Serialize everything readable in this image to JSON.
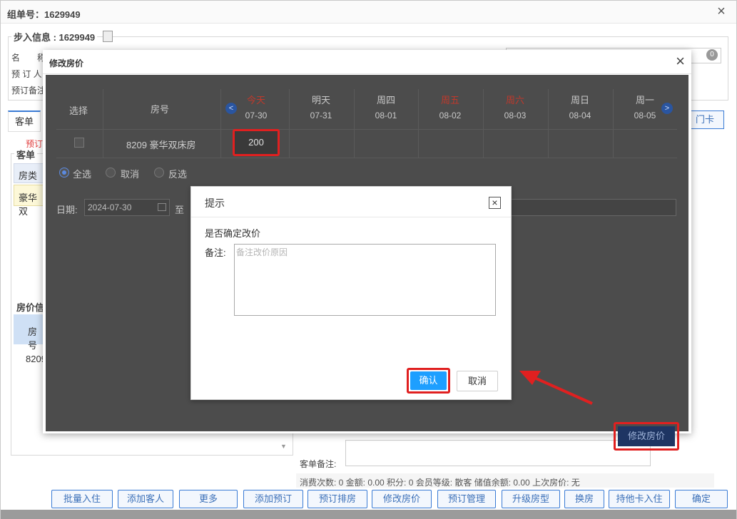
{
  "window": {
    "title": "组单号：1629949",
    "close": "×"
  },
  "step_info": {
    "legend": "步入信息 : 1629949",
    "name_label": "名　　称",
    "booker_label": "预 订 人",
    "remark_label": "预订备注",
    "badge": "0"
  },
  "tabs": {
    "guest_order": "客单",
    "booking": "预订",
    "door_card": "门卡"
  },
  "left_panel": {
    "legend": "客单",
    "room_type_header": "房类",
    "room_type_value": "豪华双",
    "price_legend": "房价信",
    "room_no_header": "房号",
    "room_no_value": "8209"
  },
  "bottom_info": {
    "remark_label": "客单备注:",
    "stats": "消费次数: 0 金额: 0.00 积分: 0 会员等级: 散客 储值余额: 0.00 上次房价: 无"
  },
  "bottom_buttons": [
    "批量入住",
    "添加客人",
    "更多",
    "添加预订",
    "预订排房",
    "修改房价",
    "预订管理",
    "升级房型",
    "换房",
    "持他卡入住",
    "确定"
  ],
  "dialog": {
    "title": "修改房价",
    "close": "×",
    "col_select": "选择",
    "col_room": "房号",
    "prev": "<",
    "next": ">",
    "days": [
      {
        "name": "今天",
        "date": "07-30",
        "red": true
      },
      {
        "name": "明天",
        "date": "07-31",
        "red": false
      },
      {
        "name": "周四",
        "date": "08-01",
        "red": false
      },
      {
        "name": "周五",
        "date": "08-02",
        "red": true
      },
      {
        "name": "周六",
        "date": "08-03",
        "red": true
      },
      {
        "name": "周日",
        "date": "08-04",
        "red": false
      },
      {
        "name": "周一",
        "date": "08-05",
        "red": false
      }
    ],
    "row_room": "8209 豪华双床房",
    "row_price": "200",
    "select_all": "全选",
    "deselect": "取消",
    "invert": "反选",
    "date_label": "日期:",
    "date_from": "2024-07-30",
    "to_label": "至",
    "modify_button": "修改房价"
  },
  "prompt": {
    "title": "提示",
    "close": "×",
    "message": "是否确定改价",
    "note_label": "备注:",
    "note_placeholder": "备注改价原因",
    "ok": "确认",
    "cancel": "取消"
  },
  "colors": {
    "accent": "#1e9fff",
    "highlight": "#e02020"
  }
}
